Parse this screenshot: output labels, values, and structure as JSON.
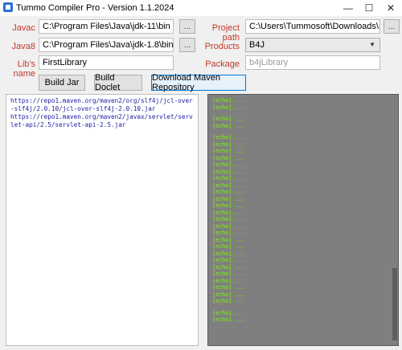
{
  "window": {
    "title": "Tummo Compiler Pro - Version 1.1.2024",
    "minimize": "—",
    "maximize": "☐",
    "close": "✕"
  },
  "form": {
    "javac_label": "Javac",
    "javac_value": "C:\\Program Files\\Java\\jdk-11\\bin",
    "java8_label": "Java8",
    "java8_value": "C:\\Program Files\\Java\\jdk-1.8\\bin",
    "libname_label": "Lib's name",
    "libname_value": "FirstLibrary",
    "projectpath_label": "Project path",
    "projectpath_value": "C:\\Users\\Tummosoft\\Downloads\\SimpleLibrary",
    "products_label": "Products",
    "products_value": "B4J",
    "package_label": "Package",
    "package_placeholder": "b4jLibrary",
    "browse": "..."
  },
  "buttons": {
    "build_jar": "Build Jar",
    "build_doclet": "Build Doclet",
    "download_maven": "Download Maven Repository"
  },
  "maven_links": [
    "https://repo1.maven.org/maven2/org/slf4j/jcl-over-slf4j/2.0.10/jcl-over-slf4j-2.0.10.jar",
    "https://repo1.maven.org/maven2/javax/servlet/servlet-api/2.5/servlet-api-2.5.jar"
  ],
  "console_lines": [
    "[echo] ...",
    "[echo] ...",
    "",
    "[echo] ...",
    "[echo] ...",
    "",
    "[echo] ...",
    "[echo] ...",
    "[echo] ...",
    "[echo] ...",
    "[echo] ...",
    "[echo] ...",
    "[echo] ...",
    "[echo] ...",
    "[echo] ...",
    "[echo] ...",
    "[echo] ...",
    "[echo] ...",
    "[echo] ...",
    "[echo] ...",
    "[echo] ...",
    "[echo] ...",
    "[echo] ...",
    "[echo] ...",
    "[echo] ...",
    "[echo] ...",
    "[echo] ...",
    "[echo] ...",
    "[echo] ...",
    "[echo] ...",
    "[echo] ...",
    "",
    "[echo] ...",
    "[echo] ..."
  ],
  "colors": {
    "label_red": "#c0392b",
    "console_bg": "#7f7f7f",
    "console_text": "#7cfc00",
    "link_blue": "#1a1aa0"
  }
}
